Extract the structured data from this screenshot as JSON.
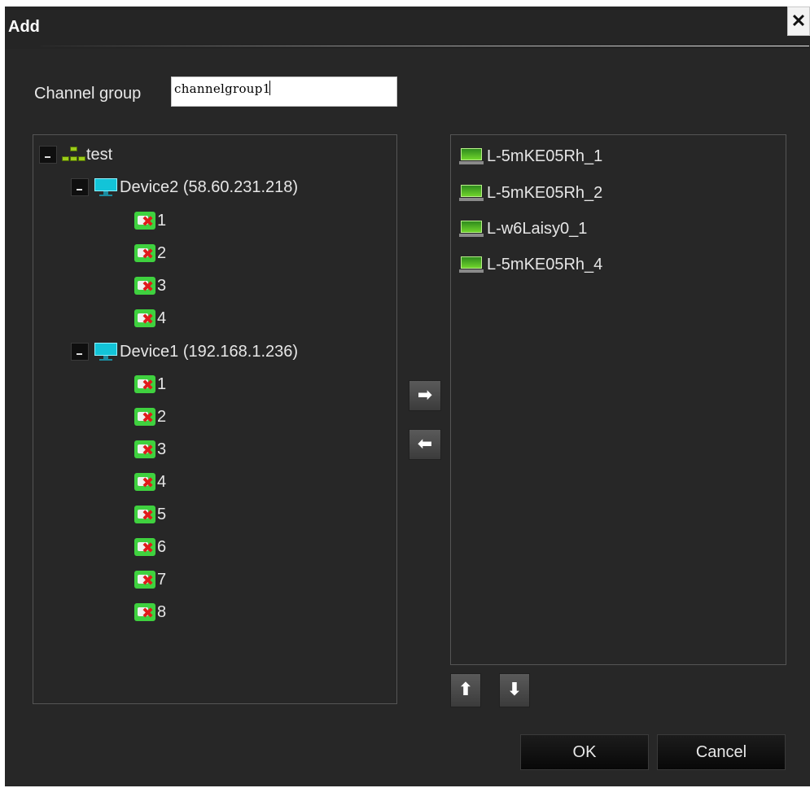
{
  "dialog": {
    "title": "Add",
    "close_glyph": "✕"
  },
  "form": {
    "channel_group_label": "Channel group",
    "channel_group_value": "channelgroup1"
  },
  "tree": {
    "root_label": "test",
    "devices": [
      {
        "label": "Device2 (58.60.231.218)",
        "channels": [
          "1",
          "2",
          "3",
          "4"
        ]
      },
      {
        "label": "Device1 (192.168.1.236)",
        "channels": [
          "1",
          "2",
          "3",
          "4",
          "5",
          "6",
          "7",
          "8"
        ]
      }
    ]
  },
  "selected": {
    "items": [
      "L-5mKE05Rh_1",
      "L-5mKE05Rh_2",
      "L-w6Laisy0_1",
      "L-5mKE05Rh_4"
    ]
  },
  "buttons": {
    "add_glyph": "➡",
    "remove_glyph": "⬅",
    "up_glyph": "⬆",
    "down_glyph": "⬇",
    "ok_label": "OK",
    "cancel_label": "Cancel"
  },
  "icons": {
    "root": "network-icon",
    "device": "monitor-icon",
    "channel": "camera-offline-icon",
    "selected_channel": "camera-channel-icon"
  },
  "colors": {
    "background": "#272727",
    "camera_green": "#3fd13f",
    "offline_x": "#e01b1b",
    "monitor_cyan": "#12c4d8"
  }
}
